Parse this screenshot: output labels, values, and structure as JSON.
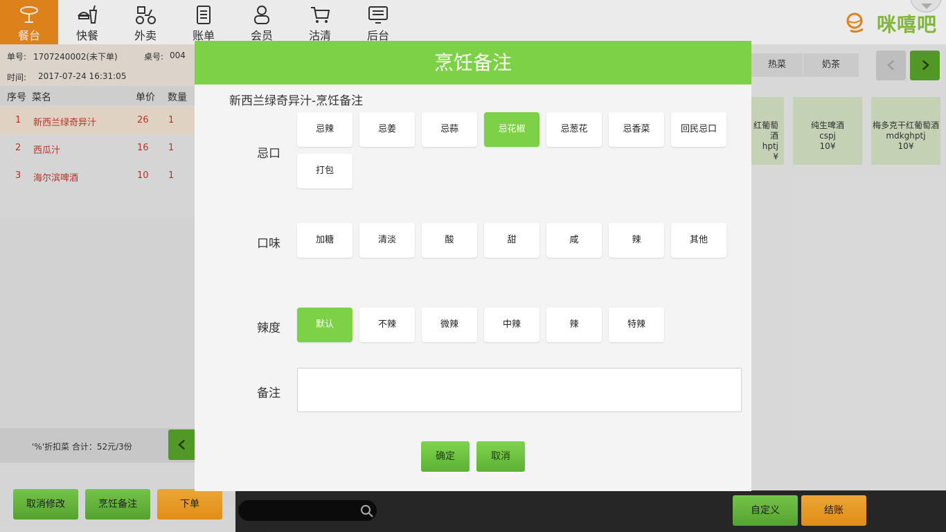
{
  "nav": {
    "items": [
      {
        "label": "餐台",
        "icon": "table-icon",
        "active": true
      },
      {
        "label": "快餐",
        "icon": "fastfood-icon"
      },
      {
        "label": "外卖",
        "icon": "delivery-icon"
      },
      {
        "label": "账单",
        "icon": "bill-icon"
      },
      {
        "label": "会员",
        "icon": "member-icon"
      },
      {
        "label": "沽清",
        "icon": "cart-icon"
      },
      {
        "label": "后台",
        "icon": "monitor-icon"
      }
    ],
    "logo": "咪嘻吧"
  },
  "order": {
    "no_label": "单号:",
    "no_value": "1707240002(未下单)",
    "table_label": "桌号:",
    "table_value": "004",
    "time_label": "时间:",
    "time_value": "2017-07-24 16:31:05"
  },
  "table": {
    "headers": [
      "序号",
      "菜名",
      "单价",
      "数量"
    ],
    "rows": [
      {
        "idx": "1",
        "name": "新西兰绿奇异汁",
        "price": "26",
        "qty": "1"
      },
      {
        "idx": "2",
        "name": "西瓜汁",
        "price": "16",
        "qty": "1"
      },
      {
        "idx": "3",
        "name": "海尔滨啤酒",
        "price": "10",
        "qty": "1"
      }
    ]
  },
  "summary": "'%'折扣菜 合计：52元/3份",
  "left_buttons": {
    "cancel": "取消修改",
    "cooking_note": "烹饪备注",
    "place_order": "下单"
  },
  "right": {
    "tabs": [
      "热菜",
      "奶茶"
    ],
    "cards": [
      {
        "name": "红葡萄酒",
        "code": "hptj",
        "price": "¥"
      },
      {
        "name": "纯生啤酒",
        "code": "cspj",
        "price": "10¥"
      },
      {
        "name": "梅多克干红葡萄酒",
        "code": "mdkghptj",
        "price": "10¥"
      }
    ],
    "custom_button": "自定义",
    "checkout_button": "结账"
  },
  "modal": {
    "title": "烹饪备注",
    "subtitle": "新西兰绿奇异汁-烹饪备注",
    "taboo": {
      "label": "忌口",
      "options": [
        "忌辣",
        "忌姜",
        "忌蒜",
        "忌花椒",
        "忌葱花",
        "忌香菜",
        "回民忌口",
        "打包"
      ],
      "selected": "忌花椒"
    },
    "flavor": {
      "label": "口味",
      "options": [
        "加糖",
        "清淡",
        "酸",
        "甜",
        "咸",
        "辣",
        "其他"
      ]
    },
    "spice": {
      "label": "辣度",
      "options": [
        "默认",
        "不辣",
        "微辣",
        "中辣",
        "辣",
        "特辣"
      ],
      "selected": "默认"
    },
    "remark": {
      "label": "备注",
      "value": ""
    },
    "confirm": "确定",
    "cancel": "取消"
  },
  "colors": {
    "accent_green": "#7cd146",
    "nav_active": "#f08c1e",
    "order_text": "#c0392b"
  }
}
